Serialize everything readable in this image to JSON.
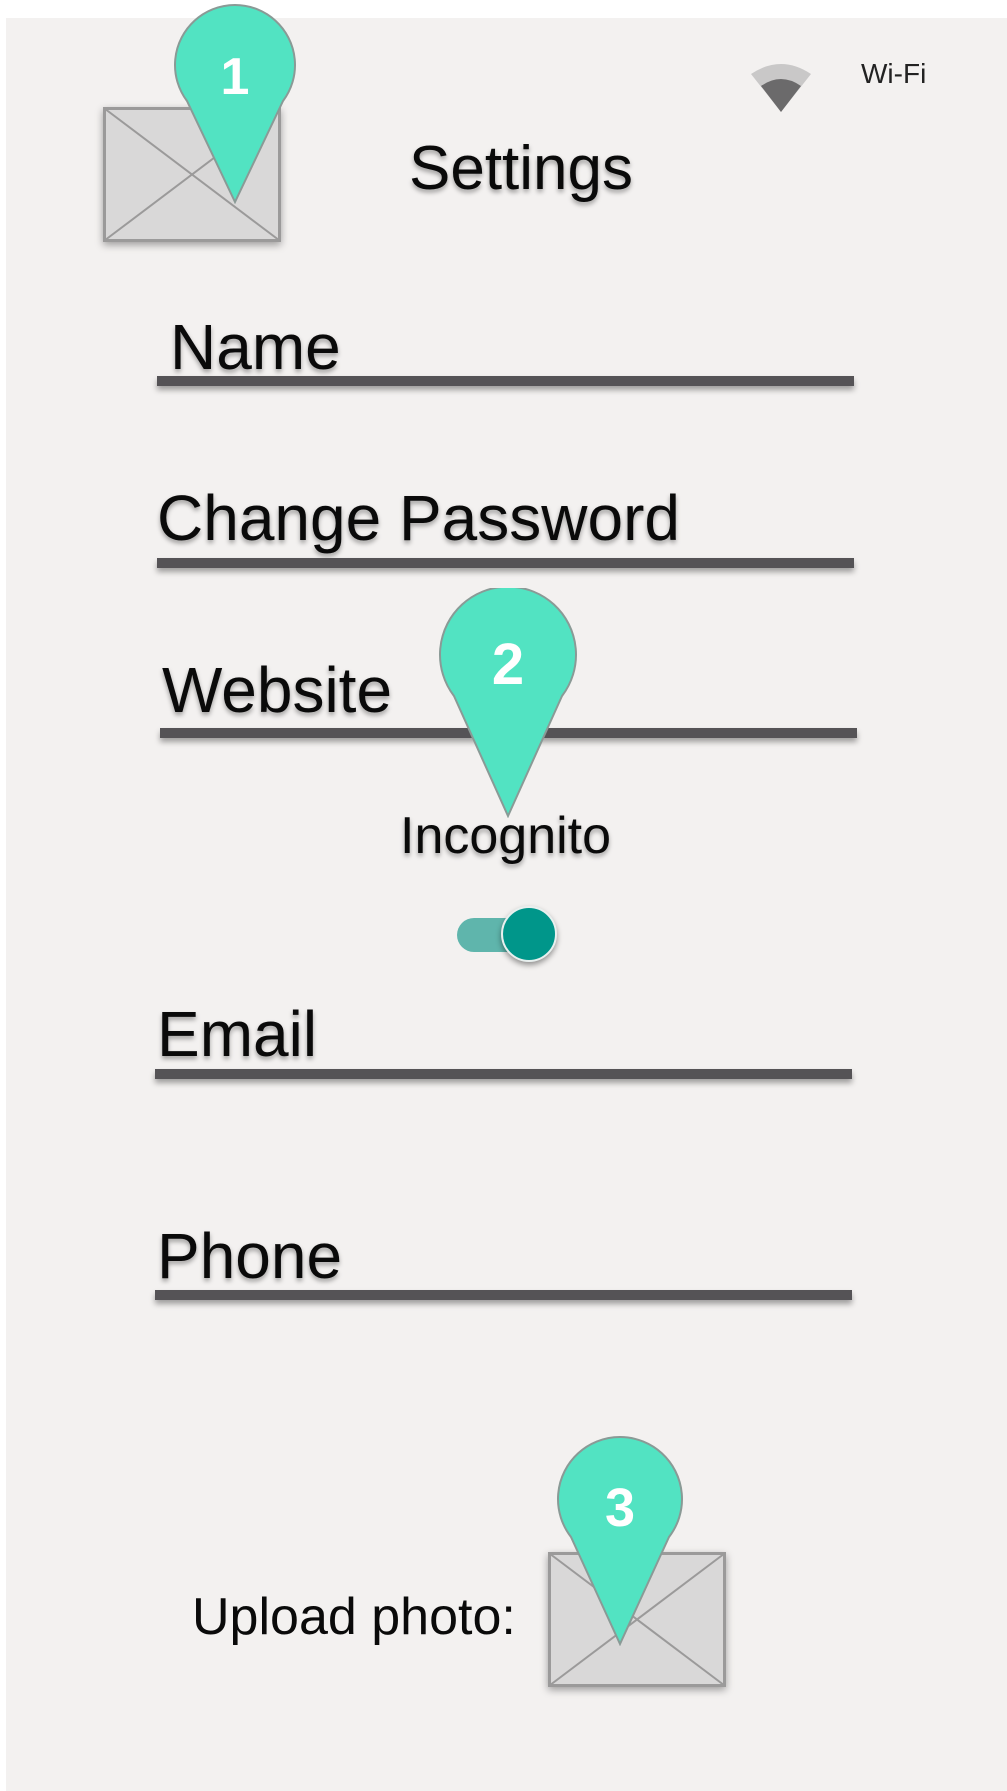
{
  "status_bar": {
    "wifi_label": "Wi-Fi",
    "wifi_icon": "wifi-icon"
  },
  "header": {
    "title": "Settings",
    "avatar_icon": "image-placeholder-icon"
  },
  "fields": [
    {
      "label": "Name"
    },
    {
      "label": "Change Password"
    },
    {
      "label": "Website"
    },
    {
      "label": "Email"
    },
    {
      "label": "Phone"
    }
  ],
  "incognito": {
    "label": "Incognito",
    "enabled": true
  },
  "upload": {
    "label": "Upload photo:",
    "icon": "image-placeholder-icon"
  },
  "annotations": [
    {
      "number": "1"
    },
    {
      "number": "2"
    },
    {
      "number": "3"
    }
  ],
  "colors": {
    "background": "#f3f1f0",
    "field_underline": "#555356",
    "toggle_track": "#5fb5ac",
    "toggle_thumb": "#00968a",
    "annotation_pin": "#52e3c2"
  }
}
